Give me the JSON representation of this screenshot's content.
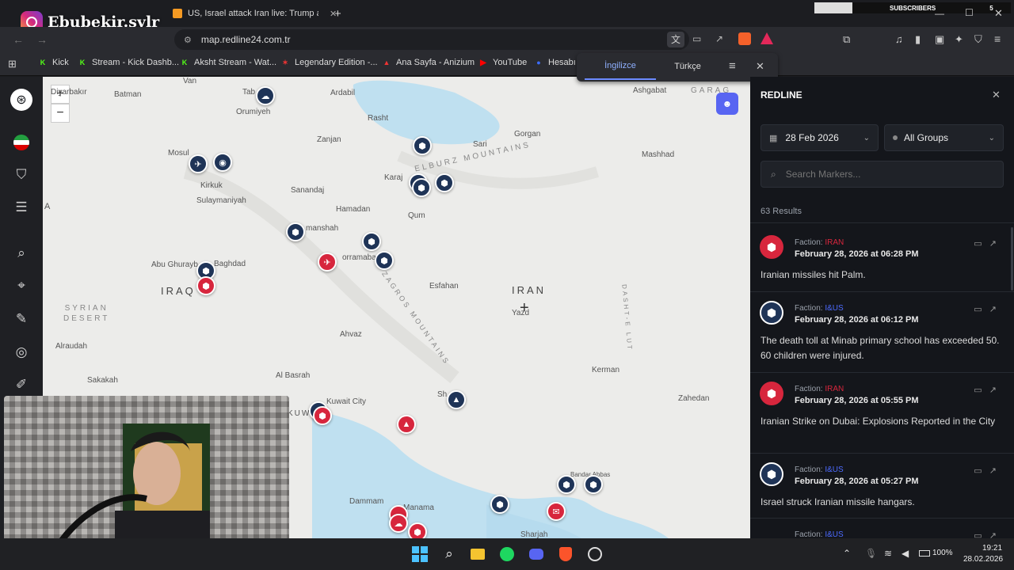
{
  "overlay": {
    "channel": "Ebubekir.sylr"
  },
  "browser": {
    "tabs": [
      {
        "title": "US, Israel attack Iran live: Trump anno",
        "active": true
      }
    ],
    "new_tab": "+",
    "url": "map.redline24.com.tr",
    "subscribers_label": "SUBSCRIBERS",
    "subscribers_count": "5",
    "bookmarks": [
      "Kick",
      "Stream - Kick Dashb...",
      "Aksht Stream - Wat...",
      "Legendary Edition -...",
      "Ana Sayfa - Anizium",
      "YouTube",
      "Hesabı"
    ]
  },
  "translate_bar": {
    "lang1": "İngilizce",
    "lang2": "Türkçe"
  },
  "map": {
    "zoom_in": "+",
    "zoom_out": "−",
    "labels": {
      "van": "Van",
      "tabriz": "Tab",
      "urumiyeh": "Orumiyeh",
      "ardabil": "Ardabil",
      "ashgabat": "Ashgabat",
      "rasht": "Rasht",
      "gorgan": "Gorgan",
      "sari": "Sari",
      "mashhad": "Mashhad",
      "zanjan": "Zanjan",
      "karaj": "Karaj",
      "qom": "Qum",
      "hamadan": "Hamadan",
      "sanandaj": "Sanandaj",
      "kermanshah": "manshah",
      "khorramabad": "orramabad",
      "mosul": "Mosul",
      "kirkuk": "Kirkuk",
      "sulaymaniyah": "Sulaymaniyah",
      "diyarbakir": "Diyarbakır",
      "batman": "Batman",
      "baghdad": "Baghdad",
      "abu_ghurayb": "Abu Ghurayb",
      "iraq": "IRAQ",
      "syrian_desert": "SYRIAN\nDESERT",
      "esfahan": "Esfahan",
      "iran": "IRAN",
      "yazd": "Yazd",
      "ahvaz": "Ahvaz",
      "alraudah": "Alraudah",
      "sakakah": "Sakakah",
      "al_basrah": "Al Basrah",
      "kuwait_city": "Kuwait City",
      "kuwait": "KUWA",
      "kerman": "Kerman",
      "zahedan": "Zahedan",
      "shiraz": "Sh",
      "dammam": "Dammam",
      "manama": "Manama",
      "bandar": "Bandar Abbas",
      "sharjah": "Sharjah",
      "dasht": "DASHT-E LUT",
      "zagros": "ZAGROS MOUNTAINS",
      "elburz": "ELBURZ MOUNTAINS",
      "garagum": "GARAG",
      "a_left": "A"
    }
  },
  "sidebar": {
    "title": "REDLINE",
    "date_filter": "28 Feb 2026",
    "group_filter": "All Groups",
    "search_placeholder": "Search Markers...",
    "results": "63 Results",
    "faction_label": "Faction:",
    "items": [
      {
        "faction": "IRAN",
        "faction_color": "#d7263d",
        "date": "February 28, 2026 at 06:28 PM",
        "text": "Iranian missiles hit Palm."
      },
      {
        "faction": "I&US",
        "faction_color": "#4d6bff",
        "date": "February 28, 2026 at 06:12 PM",
        "text": "The death toll at Minab primary school has exceeded 50. 60 children were injured."
      },
      {
        "faction": "IRAN",
        "faction_color": "#d7263d",
        "date": "February 28, 2026 at 05:55 PM",
        "text": "Iranian Strike on Dubai: Explosions Reported in the City"
      },
      {
        "faction": "I&US",
        "faction_color": "#4d6bff",
        "date": "February 28, 2026 at 05:27 PM",
        "text": "Israel struck Iranian missile hangars."
      },
      {
        "faction": "I&US",
        "faction_color": "#4d6bff",
        "date": "",
        "text": ""
      }
    ]
  },
  "taskbar": {
    "battery": "100%",
    "time": "19:21",
    "date": "28.02.2026"
  }
}
